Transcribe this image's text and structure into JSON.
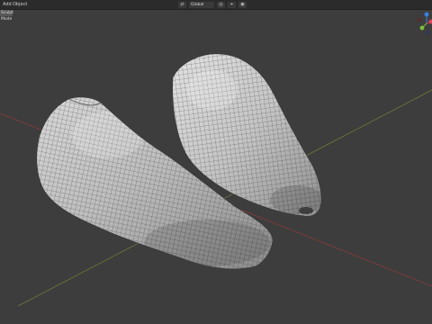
{
  "header": {
    "menus": [
      "Add",
      "Object"
    ],
    "transform_orientation": "Global",
    "mode_label": "Sculpt Mode"
  },
  "viewport": {
    "background": "#3d3d3d",
    "axis_x_color": "#8a3a3a",
    "axis_y_color": "#6a7a3a",
    "objects": [
      "mesh-left",
      "mesh-right"
    ]
  },
  "gizmo": {
    "x_color": "#e0465a",
    "y_color": "#7fbf3a",
    "z_color": "#3c7fe0"
  }
}
